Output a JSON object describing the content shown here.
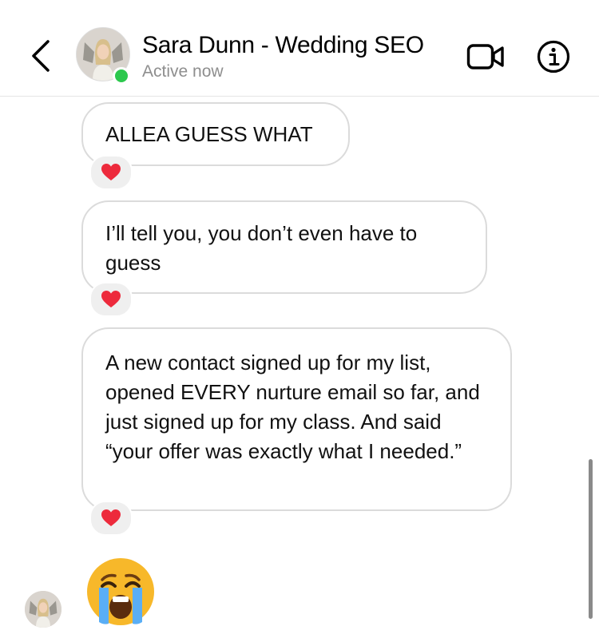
{
  "header": {
    "contact_name": "Sara Dunn - Wedding SEO",
    "status": "Active now",
    "back_icon": "chevron-left-icon",
    "video_icon": "video-camera-icon",
    "info_icon": "info-icon"
  },
  "messages": [
    {
      "text": "ALLEA GUESS WHAT",
      "reaction": "❤️"
    },
    {
      "text": "I’ll tell you, you don’t even have to guess",
      "reaction": "❤️"
    },
    {
      "text": "A new contact signed up for my list, opened EVERY nurture email so far, and just signed up for my class. And said “your offer was exactly what I needed.”",
      "reaction": "❤️"
    }
  ],
  "last_message": {
    "type": "emoji",
    "emoji": "😭",
    "icon": "loudly-crying-face-icon"
  },
  "colors": {
    "bubble_border": "#dbdbdb",
    "reaction_bg": "#efefef",
    "online_green": "#2cc84d",
    "status_gray": "#8e8e8e",
    "heart_red": "#ed2a3c"
  }
}
